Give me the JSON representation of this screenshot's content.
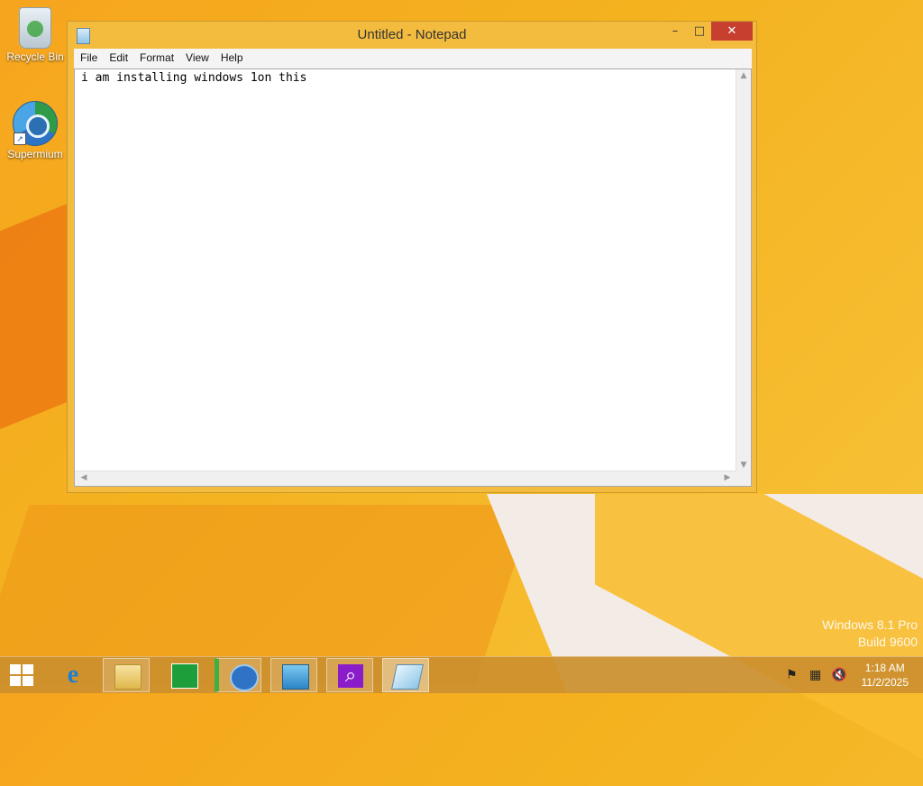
{
  "desktop": {
    "icons": [
      {
        "label": "Recycle Bin",
        "icon": "recycle-bin-icon"
      },
      {
        "label": "Supermium",
        "icon": "supermium-browser-icon"
      }
    ],
    "watermark": {
      "line1": "Windows 8.1 Pro",
      "line2": "Build 9600"
    }
  },
  "notepad": {
    "title": "Untitled - Notepad",
    "controls": {
      "minimize": "–",
      "maximize": "□",
      "close": "✕"
    },
    "menu": [
      "File",
      "Edit",
      "Format",
      "View",
      "Help"
    ],
    "content": "i am installing windows 1on this"
  },
  "taskbar": {
    "items": [
      "start-button",
      "internet-explorer",
      "file-explorer",
      "windows-store",
      "supermium",
      "app-5",
      "search-app",
      "notepad"
    ],
    "tray_icons": [
      "action-center-flag-icon",
      "network-icon",
      "volume-muted-icon"
    ],
    "time": "1:18 AM",
    "date": "11/2/2025"
  },
  "colors": {
    "accent": "#f4bc3f",
    "close_button": "#c7402f",
    "taskbar": "#cc8f2e"
  }
}
